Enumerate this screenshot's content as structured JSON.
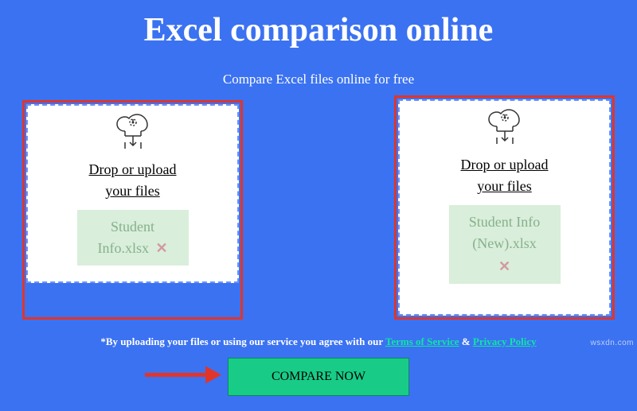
{
  "header": {
    "title": "Excel comparison online",
    "subtitle": "Compare Excel files online for free"
  },
  "dropzones": {
    "label_line1": "Drop or upload",
    "label_line2": "your files",
    "left": {
      "filename": "Student Info.xlsx",
      "remove_symbol": "✕"
    },
    "right": {
      "filename": "Student Info (New).xlsx",
      "remove_symbol": "✕"
    }
  },
  "terms": {
    "prefix": "*By uploading your files or using our service you agree with our ",
    "tos": "Terms of Service",
    "amp": " & ",
    "privacy": "Privacy Policy"
  },
  "compare_button": "COMPARE NOW",
  "watermark": "wsxdn.com"
}
